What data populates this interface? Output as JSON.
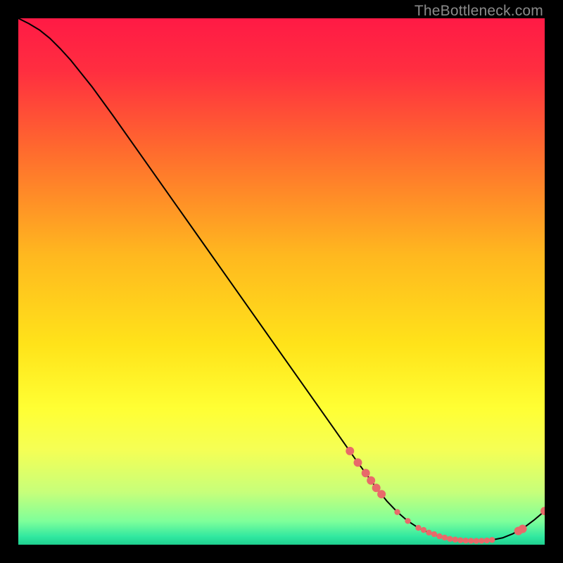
{
  "watermark": "TheBottleneck.com",
  "chart_data": {
    "type": "line",
    "title": "",
    "xlabel": "",
    "ylabel": "",
    "xlim": [
      0,
      100
    ],
    "ylim": [
      0,
      100
    ],
    "grid": false,
    "background_gradient_stops": [
      {
        "pos": 0.0,
        "color": "#ff1a45"
      },
      {
        "pos": 0.1,
        "color": "#ff2e40"
      },
      {
        "pos": 0.25,
        "color": "#ff6a2e"
      },
      {
        "pos": 0.45,
        "color": "#ffb81f"
      },
      {
        "pos": 0.62,
        "color": "#ffe31a"
      },
      {
        "pos": 0.74,
        "color": "#ffff33"
      },
      {
        "pos": 0.82,
        "color": "#f5ff55"
      },
      {
        "pos": 0.9,
        "color": "#c7ff7a"
      },
      {
        "pos": 0.955,
        "color": "#7fff9a"
      },
      {
        "pos": 0.985,
        "color": "#30e8a0"
      },
      {
        "pos": 1.0,
        "color": "#1fcf8f"
      }
    ],
    "series": [
      {
        "name": "bottleneck-curve",
        "color": "#000000",
        "x": [
          0,
          2,
          4,
          6,
          8,
          10,
          14,
          18,
          24,
          30,
          36,
          42,
          48,
          54,
          60,
          64,
          68,
          70,
          72,
          74,
          76,
          78,
          80,
          82,
          84,
          86,
          88,
          90,
          92,
          94,
          96,
          98,
          100
        ],
        "y": [
          100,
          99,
          97.8,
          96.2,
          94.2,
          92.0,
          87.0,
          81.5,
          73.0,
          64.5,
          56.0,
          47.5,
          39.0,
          30.5,
          22.0,
          16.3,
          10.8,
          8.3,
          6.2,
          4.5,
          3.2,
          2.3,
          1.6,
          1.1,
          0.85,
          0.75,
          0.75,
          0.9,
          1.3,
          2.1,
          3.2,
          4.7,
          6.4
        ]
      }
    ],
    "markers": {
      "name": "highlight-points",
      "color": "#e86a6a",
      "radius_main": 6,
      "radius_small": 4.2,
      "x": [
        63,
        64.5,
        66,
        67,
        68,
        69,
        72,
        74,
        76,
        77,
        78,
        79,
        80,
        81,
        82,
        83,
        84,
        85,
        86,
        87,
        88,
        89,
        90,
        95,
        95.8,
        100
      ],
      "y": [
        17.8,
        15.6,
        13.6,
        12.2,
        10.8,
        9.6,
        6.2,
        4.5,
        3.2,
        2.8,
        2.3,
        2.0,
        1.6,
        1.35,
        1.1,
        0.97,
        0.85,
        0.78,
        0.75,
        0.72,
        0.75,
        0.8,
        0.9,
        2.6,
        3.0,
        6.4
      ],
      "size_class": [
        "m",
        "m",
        "m",
        "m",
        "m",
        "m",
        "s",
        "s",
        "s",
        "s",
        "s",
        "s",
        "s",
        "s",
        "s",
        "s",
        "s",
        "s",
        "s",
        "s",
        "s",
        "s",
        "s",
        "m",
        "m",
        "m"
      ]
    }
  }
}
